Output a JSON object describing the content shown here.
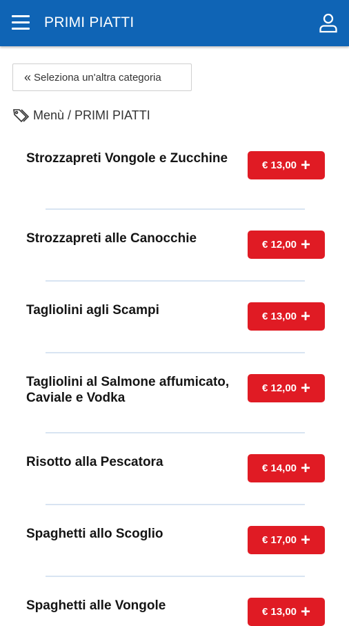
{
  "header": {
    "title": "PRIMI PIATTI",
    "menu_icon": "hamburger-icon",
    "user_icon": "user-icon"
  },
  "back_button": {
    "label": "Seleziona un'altra categoria"
  },
  "breadcrumb": {
    "text": "Menù / PRIMI PIATTI"
  },
  "colors": {
    "header": "#0f64b5",
    "price_button": "#e01b24",
    "divider": "#d8e4f2"
  },
  "items": [
    {
      "name": "Strozzapreti Vongole e Zucchine",
      "price": "€ 13,00"
    },
    {
      "name": "Strozzapreti alle Canocchie",
      "price": "€ 12,00"
    },
    {
      "name": "Tagliolini agli Scampi",
      "price": "€ 13,00"
    },
    {
      "name": "Tagliolini al Salmone affumicato, Caviale e Vodka",
      "price": "€ 12,00"
    },
    {
      "name": "Risotto alla Pescatora",
      "price": "€ 14,00"
    },
    {
      "name": "Spaghetti allo Scoglio",
      "price": "€ 17,00"
    },
    {
      "name": "Spaghetti alle Vongole",
      "price": "€ 13,00"
    }
  ]
}
